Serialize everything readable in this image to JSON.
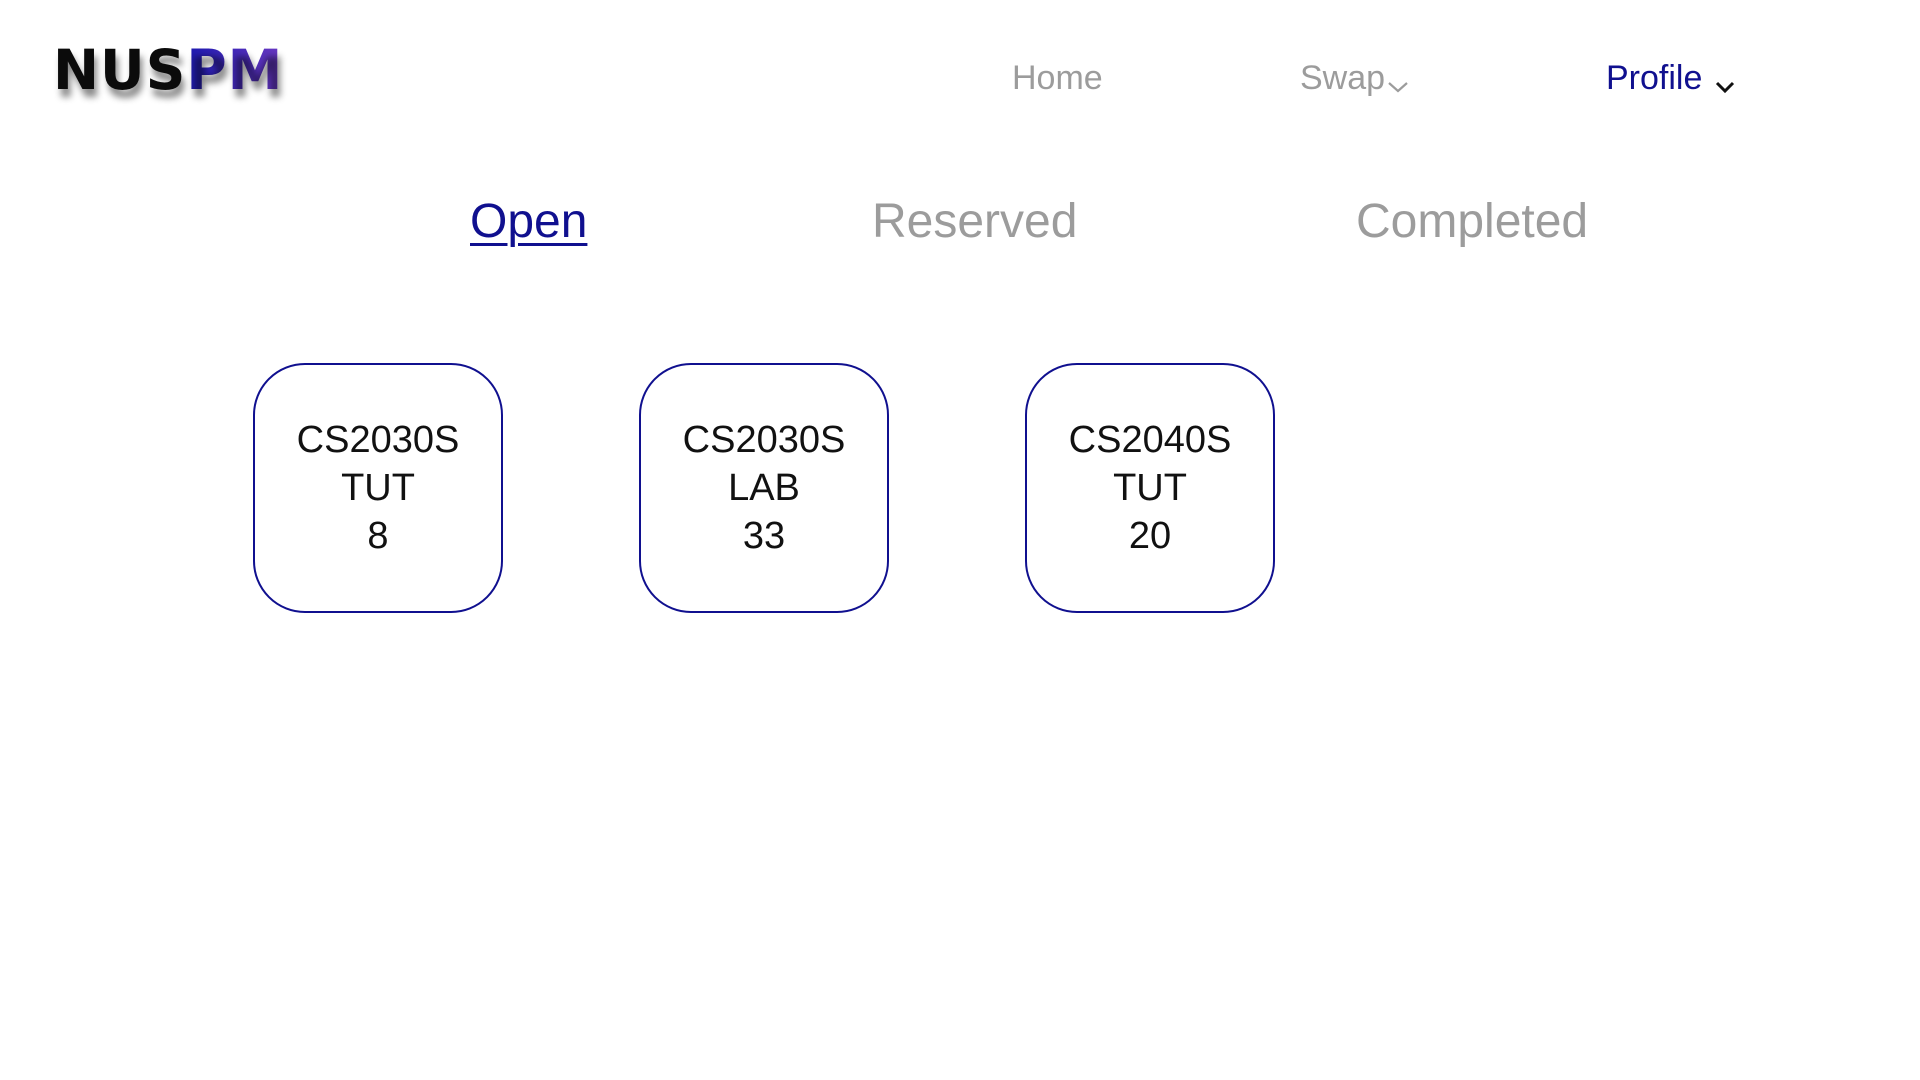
{
  "logo": {
    "part_a": "NUS",
    "part_b": "PM"
  },
  "nav": {
    "home": "Home",
    "swap": "Swap",
    "profile": "Profile"
  },
  "tabs": [
    {
      "label": "Open",
      "selected": true
    },
    {
      "label": "Reserved",
      "selected": false
    },
    {
      "label": "Completed",
      "selected": false
    }
  ],
  "slots": [
    {
      "module": "CS2030S",
      "type": "TUT",
      "number": "8"
    },
    {
      "module": "CS2030S",
      "type": "LAB",
      "number": "33"
    },
    {
      "module": "CS2040S",
      "type": "TUT",
      "number": "20"
    }
  ],
  "colors": {
    "accent": "#10108f",
    "inactive_text": "#9c9c9c",
    "logo_gradient_start": "#1c1ab0",
    "logo_gradient_end": "#6a38c2"
  },
  "icons": {
    "swap_dropdown": "chevron-down-icon",
    "profile_dropdown": "chevron-down-icon"
  }
}
